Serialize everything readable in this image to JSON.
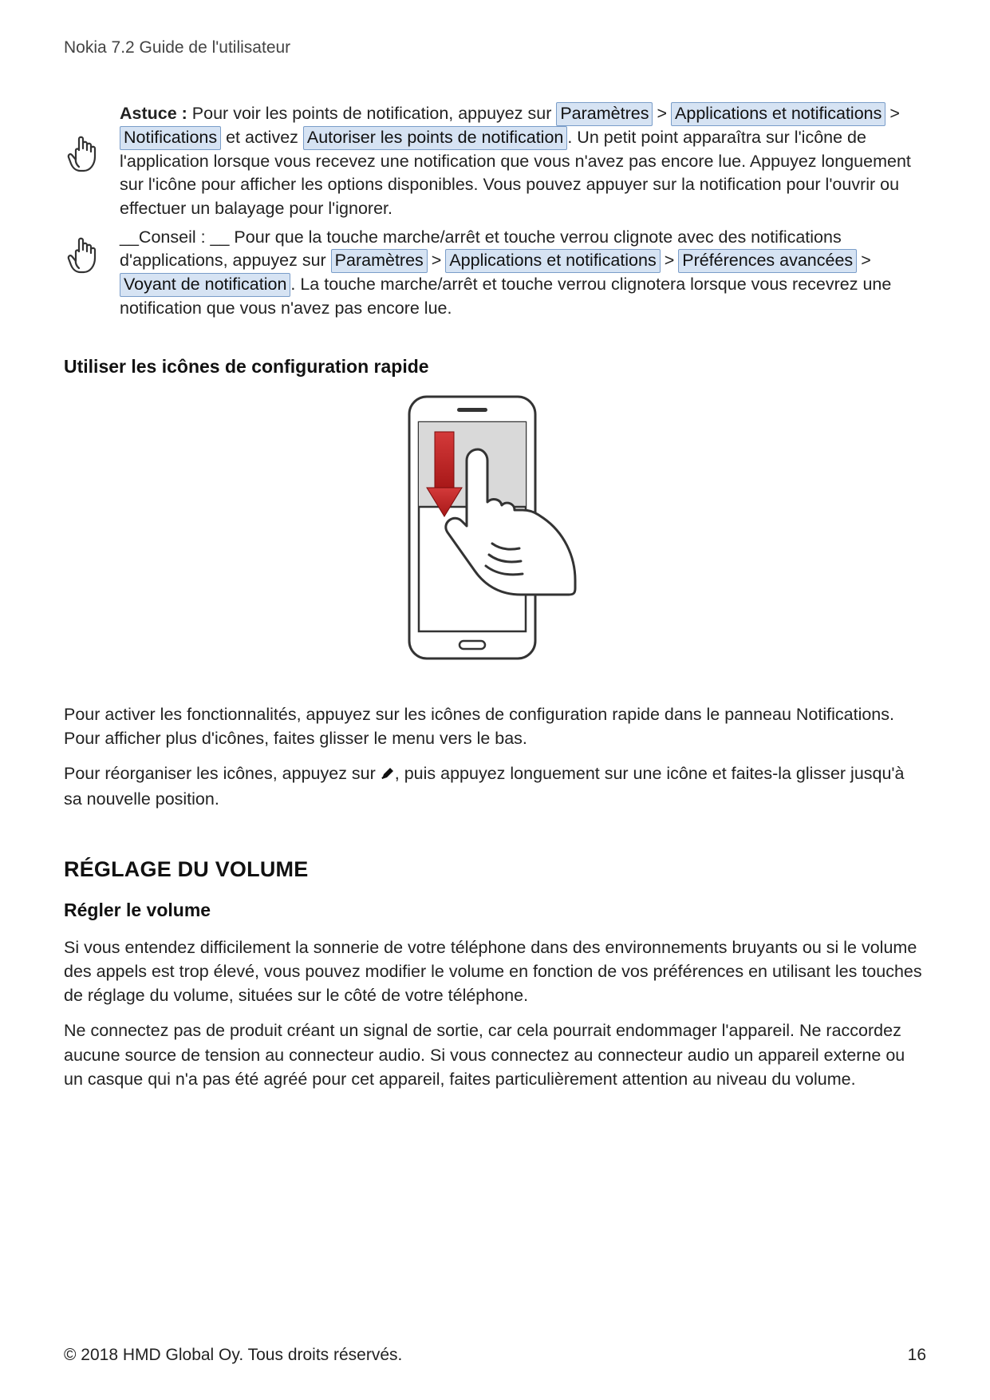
{
  "header": {
    "title": "Nokia 7.2 Guide de l'utilisateur"
  },
  "tip1": {
    "label": "Astuce :",
    "t1": " Pour voir les points de notification, appuyez sur ",
    "h1": "Paramètres",
    "h2": "Applications et notifications",
    "h3": "Notifications",
    "t2": " et activez ",
    "h4": "Autoriser les points de notification",
    "t3": ". Un petit point apparaîtra sur l'icône de l'application lorsque vous recevez une notification que vous n'avez pas encore lue. Appuyez longuement sur l'icône pour afficher les options disponibles. Vous pouvez appuyer sur la notification pour l'ouvrir ou effectuer un balayage pour l'ignorer."
  },
  "tip2": {
    "t1": "__Conseil : __ Pour que la touche marche/arrêt et touche verrou clignote avec des notifications d'applications, appuyez sur ",
    "h1": "Paramètres",
    "h2": "Applications et notifications",
    "h3": "Préférences avancées",
    "h4": "Voyant de notification",
    "t2": ". La touche marche/arrêt et touche verrou clignotera lorsque vous recevrez une notification que vous n'avez pas encore lue."
  },
  "section1": {
    "title": "Utiliser les icônes de configuration rapide",
    "p1": "Pour activer les fonctionnalités, appuyez sur les icônes de configuration rapide dans le panneau Notifications. Pour afficher plus d'icônes, faites glisser le menu vers le bas.",
    "p2a": "Pour réorganiser les icônes, appuyez sur ",
    "p2b": ", puis appuyez longuement sur une icône et faites-la glisser jusqu'à sa nouvelle position."
  },
  "section2": {
    "title": "RÉGLAGE DU VOLUME",
    "sub": "Régler le volume",
    "p1": "Si vous entendez difficilement la sonnerie de votre téléphone dans des environnements bruyants ou si le volume des appels est trop élevé, vous pouvez modifier le volume en fonction de vos préférences en utilisant les touches de réglage du volume, situées sur le côté de votre téléphone.",
    "p2": "Ne connectez pas de produit créant un signal de sortie, car cela pourrait endommager l'appareil. Ne raccordez aucune source de tension au connecteur audio. Si vous connectez au connecteur audio un appareil externe ou un casque qui n'a pas été agréé pour cet appareil, faites particulièrement attention au niveau du volume."
  },
  "footer": {
    "copyright": "© 2018 HMD Global Oy. Tous droits réservés.",
    "page": "16"
  },
  "icons": {
    "hand_up": "hand-point-up-icon",
    "pen": "pen-edit-icon",
    "phone_swipe": "phone-swipe-down-illustration"
  }
}
